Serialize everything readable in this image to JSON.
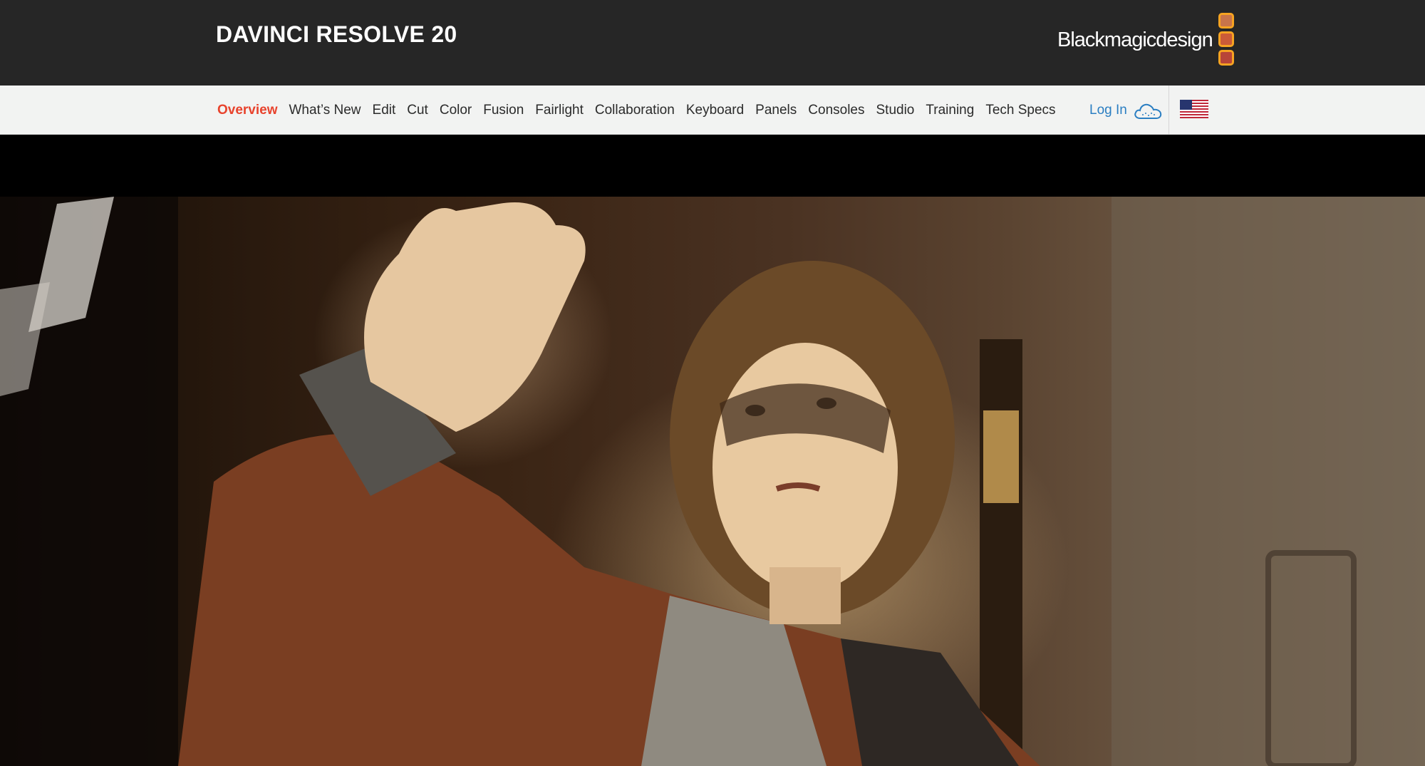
{
  "header": {
    "product_title": "DAVINCI RESOLVE 20",
    "brand_logo_text": "Blackmagicdesign",
    "brand_colors": {
      "square_1": "#c8744a",
      "square_2": "#cb5b38",
      "square_3": "#b84538",
      "square_border": "#f6a321"
    }
  },
  "nav": {
    "items": [
      {
        "label": "Overview",
        "active": true
      },
      {
        "label": "What’s New"
      },
      {
        "label": "Edit"
      },
      {
        "label": "Cut"
      },
      {
        "label": "Color"
      },
      {
        "label": "Fusion"
      },
      {
        "label": "Fairlight"
      },
      {
        "label": "Collaboration"
      },
      {
        "label": "Keyboard"
      },
      {
        "label": "Panels"
      },
      {
        "label": "Consoles"
      },
      {
        "label": "Studio"
      },
      {
        "label": "Training"
      },
      {
        "label": "Tech Specs"
      }
    ],
    "active_color": "#e8432d",
    "login_label": "Log In",
    "login_icon": "cloud-icon",
    "region_icon": "us-flag-icon"
  },
  "hero": {
    "image_icon": "hero-image"
  }
}
